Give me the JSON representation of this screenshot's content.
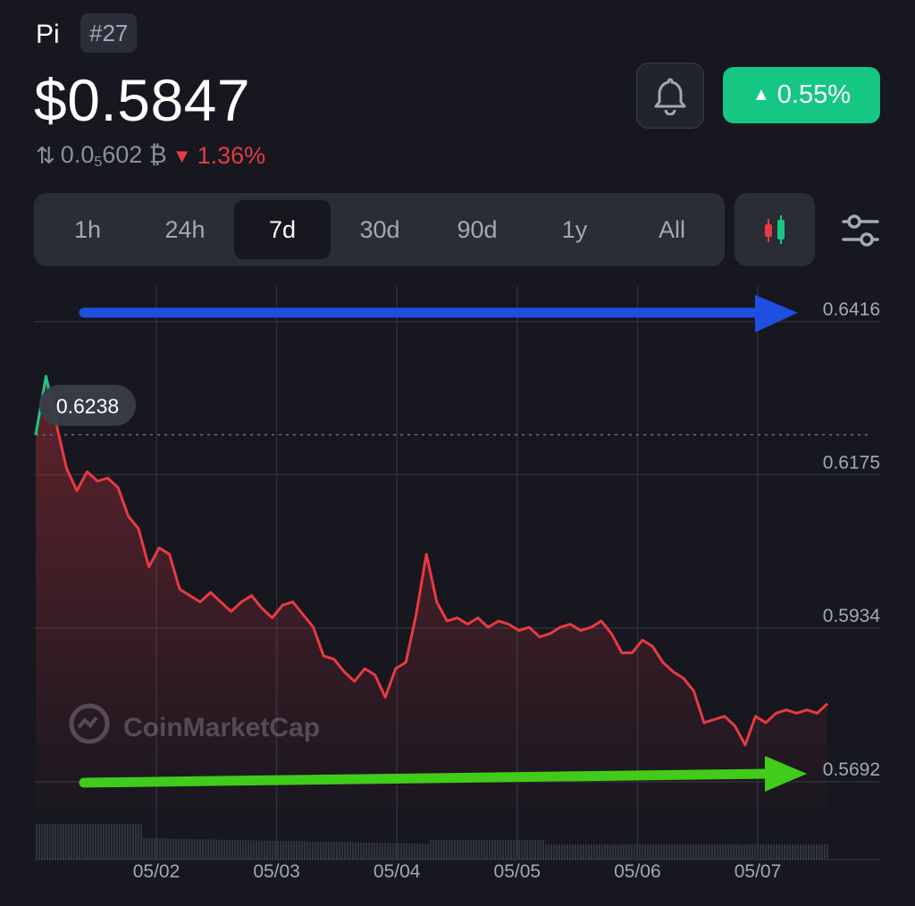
{
  "header": {
    "coin_name": "Pi",
    "rank": "#27",
    "price": "$0.5847",
    "btc_price_prefix": "0.0",
    "btc_price_sub": "5",
    "btc_price_suffix": "602 ₿",
    "btc_change": "1.36%",
    "change_24h": "0.55%"
  },
  "tabs": [
    "1h",
    "24h",
    "7d",
    "30d",
    "90d",
    "1y",
    "All"
  ],
  "active_tab": "7d",
  "colors": {
    "background": "#16171f",
    "up": "#16c784",
    "down": "#ea3943",
    "annotation_top_arrow": "#1f4fe0",
    "annotation_bottom_arrow": "#3fcc1a"
  },
  "chart_data": {
    "type": "line",
    "y_tick_labels": [
      "0.6416",
      "0.6175",
      "0.5934",
      "0.5692"
    ],
    "x_tick_labels": [
      "05/02",
      "05/03",
      "05/04",
      "05/05",
      "05/06",
      "05/07"
    ],
    "ylim": [
      0.5692,
      0.6416
    ],
    "grid": true,
    "open_price": 0.6238,
    "open_price_label": "0.6238",
    "watermark": "CoinMarketCap",
    "series": [
      {
        "x": [
          "05/01 03:00",
          "05/01 05:00",
          "05/01 07:00",
          "05/01 09:00",
          "05/01 11:00",
          "05/01 13:00",
          "05/01 15:00",
          "05/01 17:00",
          "05/01 19:00",
          "05/01 21:00",
          "05/01 23:00",
          "05/02 01:00",
          "05/02 03:00",
          "05/02 05:00",
          "05/02 07:00",
          "05/02 09:00",
          "05/02 11:00",
          "05/02 13:00",
          "05/02 15:00",
          "05/02 17:00",
          "05/02 19:00",
          "05/02 21:00",
          "05/02 23:00",
          "05/03 01:00",
          "05/03 03:00",
          "05/03 05:00",
          "05/03 07:00",
          "05/03 09:00",
          "05/03 11:00",
          "05/03 13:00",
          "05/03 15:00",
          "05/03 17:00",
          "05/03 19:00",
          "05/03 21:00",
          "05/03 23:00",
          "05/04 01:00",
          "05/04 03:00",
          "05/04 05:00",
          "05/04 07:00",
          "05/04 09:00",
          "05/04 11:00",
          "05/04 13:00",
          "05/04 15:00",
          "05/04 17:00",
          "05/04 19:00",
          "05/04 21:00",
          "05/04 23:00",
          "05/05 01:00",
          "05/05 03:00",
          "05/05 05:00",
          "05/05 07:00",
          "05/05 09:00",
          "05/05 11:00",
          "05/05 13:00",
          "05/05 15:00",
          "05/05 17:00",
          "05/05 19:00",
          "05/05 21:00",
          "05/05 23:00",
          "05/06 01:00",
          "05/06 03:00",
          "05/06 05:00",
          "05/06 07:00",
          "05/06 09:00",
          "05/06 11:00",
          "05/06 13:00",
          "05/06 15:00",
          "05/06 17:00",
          "05/06 19:00",
          "05/06 21:00",
          "05/06 23:00",
          "05/07 01:00",
          "05/07 03:00",
          "05/07 05:00",
          "05/07 07:00",
          "05/07 09:00",
          "05/07 11:00",
          "05/07 13:00"
        ],
        "values": [
          0.6238,
          0.633,
          0.6255,
          0.6185,
          0.615,
          0.618,
          0.6165,
          0.617,
          0.6155,
          0.611,
          0.609,
          0.603,
          0.606,
          0.605,
          0.5995,
          0.5985,
          0.5975,
          0.599,
          0.5975,
          0.596,
          0.5975,
          0.5985,
          0.5965,
          0.595,
          0.597,
          0.5975,
          0.5955,
          0.5935,
          0.589,
          0.5885,
          0.5865,
          0.585,
          0.587,
          0.586,
          0.5825,
          0.587,
          0.588,
          0.5955,
          0.605,
          0.5975,
          0.5945,
          0.595,
          0.594,
          0.595,
          0.5935,
          0.5945,
          0.594,
          0.593,
          0.5935,
          0.592,
          0.5925,
          0.5935,
          0.594,
          0.593,
          0.5935,
          0.5945,
          0.5925,
          0.5895,
          0.5895,
          0.5915,
          0.5905,
          0.588,
          0.5865,
          0.5855,
          0.5835,
          0.5785,
          0.579,
          0.5795,
          0.578,
          0.575,
          0.5795,
          0.5785,
          0.58,
          0.5805,
          0.58,
          0.5805,
          0.58,
          0.5815
        ]
      }
    ]
  }
}
